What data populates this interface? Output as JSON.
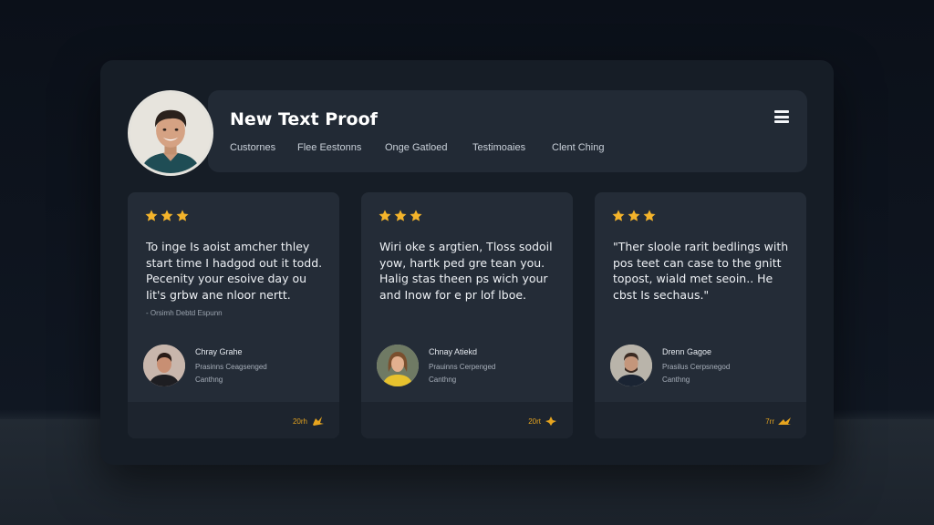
{
  "header": {
    "title": "New Text Proof",
    "nav": [
      "Custornes",
      "Flee Eestonns",
      "Onge Gatloed",
      "Testimoaies",
      "Clent Ching"
    ],
    "menu_icon": "hamburger-menu-icon"
  },
  "colors": {
    "star": "#f4b42b",
    "accent": "#e6a41f",
    "panel": "#161d26",
    "card": "#242c37"
  },
  "testimonials": [
    {
      "rating": 3,
      "quote": [
        "To inge Is aoist amcher thley",
        "start time I hadgod out it todd.",
        "Pecenity your esoive day ou",
        "Iit's grbw ane nloor nertt."
      ],
      "attribution": "- Orsimh Debtd Espunn",
      "name": "Chray Grahe",
      "role": "Prasinns Ceagsenged",
      "company": "Canthng",
      "meta": "20rh",
      "meta_icon": "award-icon"
    },
    {
      "rating": 3,
      "quote": [
        "Wiri oke s argtien, Tloss sodoil",
        "yow, hartk ped gre tean you.",
        "Halig stas theen ps wich your",
        "and Inow for e pr lof lboe."
      ],
      "attribution": "",
      "name": "Chnay Atiekd",
      "role": "Prauinns Cerpenged",
      "company": "Canthng",
      "meta": "20rt",
      "meta_icon": "award-icon"
    },
    {
      "rating": 3,
      "quote": [
        "\"Ther sloole rarit bedlings with",
        "pos teet can case to the gnitt",
        "topost, wiald met seoin.. He",
        "cbst Is sechaus.\""
      ],
      "attribution": "",
      "name": "Drenn Gagoe",
      "role": "Prasilus Cerpsnegod",
      "company": "Canthng",
      "meta": "7rr",
      "meta_icon": "award-icon"
    }
  ]
}
